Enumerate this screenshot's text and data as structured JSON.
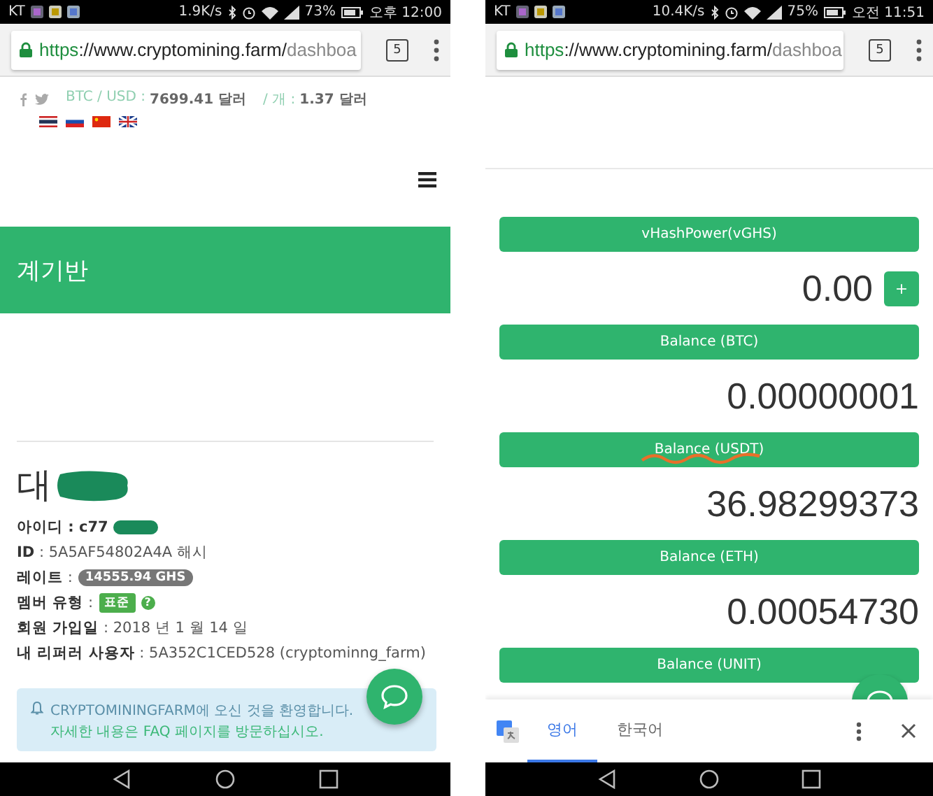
{
  "left_screen": {
    "status_bar": {
      "carrier": "KT",
      "speed": "1.9K/s",
      "battery": "73%",
      "time": "오후 12:00"
    },
    "address_bar": {
      "scheme": "https",
      "host": "://www.cryptomining.farm/",
      "path": "dashboa",
      "tab_count": "5"
    },
    "ticker": [
      {
        "label": "BTC / USD :",
        "value": "7699.41 달러"
      },
      {
        "label": "/ 개 :",
        "value": "1.37 달러"
      }
    ],
    "page_title": "계기반",
    "user_name": "대",
    "info": [
      {
        "kind": "redacted",
        "text": "아이디 : c77"
      },
      {
        "kind": "text",
        "text": "**ID** : 5A5AF54802A4A 해시"
      },
      {
        "kind": "pill",
        "text": "**레이트** :",
        "value": "14555.94 GHS"
      },
      {
        "kind": "tag",
        "text": "**멤버 유형** :",
        "value": "표준",
        "help": "?"
      },
      {
        "kind": "text",
        "text": "**회원 가입일** : 2018 년 1 월 14 일"
      },
      {
        "kind": "text",
        "text": "**내 리퍼러 사용자** : 5A352C1CED528 (cryptominng_farm)"
      }
    ],
    "alert": {
      "text": "CRYPTOMININGFARM에 오신 것을 환영합니다.",
      "link": "자세한 내용은 FAQ 페이지를 방문하십시오."
    }
  },
  "right_screen": {
    "status_bar": {
      "carrier": "KT",
      "speed": "10.4K/s",
      "battery": "75%",
      "time": "오전 11:51"
    },
    "address_bar": {
      "scheme": "https",
      "host": "://www.cryptomining.farm/",
      "path": "dashboa",
      "tab_count": "5"
    },
    "balances": [
      {
        "label": "vHashPower(vGHS)",
        "value": "0.00",
        "add_button": "+",
        "annotated": false
      },
      {
        "label": "Balance (BTC)",
        "value": "0.00000001",
        "annotated": false
      },
      {
        "label": "Balance (USDT)",
        "value": "36.98299373",
        "annotated": true
      },
      {
        "label": "Balance (ETH)",
        "value": "0.00054730",
        "annotated": false
      },
      {
        "label": "Balance (UNIT)",
        "annotated": false
      }
    ],
    "translate_bar": {
      "tabs": [
        {
          "label": "영어",
          "selected": true
        },
        {
          "label": "한국어",
          "selected": false
        }
      ]
    }
  }
}
